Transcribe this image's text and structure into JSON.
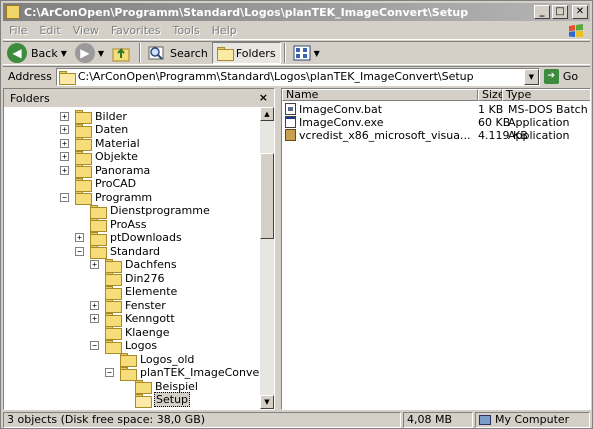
{
  "window": {
    "title": "C:\\ArConOpen\\Programm\\Standard\\Logos\\planTEK_ImageConvert\\Setup",
    "buttons": {
      "minimize": "_",
      "maximize": "□",
      "close": "✕"
    }
  },
  "menu": [
    "File",
    "Edit",
    "View",
    "Favorites",
    "Tools",
    "Help"
  ],
  "toolbar": {
    "back_label": "Back",
    "search_label": "Search",
    "folders_label": "Folders",
    "icons": [
      "back-icon",
      "forward-icon",
      "up-folder-icon",
      "search-icon",
      "folders-icon",
      "views-icon"
    ]
  },
  "address": {
    "label": "Address",
    "path": "C:\\ArConOpen\\Programm\\Standard\\Logos\\planTEK_ImageConvert\\Setup",
    "go_label": "Go"
  },
  "folders_pane": {
    "title": "Folders",
    "close": "×",
    "tree": [
      {
        "label": "Bilder",
        "expander": "+"
      },
      {
        "label": "Daten",
        "expander": "+"
      },
      {
        "label": "Material",
        "expander": "+"
      },
      {
        "label": "Objekte",
        "expander": "+"
      },
      {
        "label": "Panorama",
        "expander": "+"
      },
      {
        "label": "ProCAD",
        "expander": ""
      },
      {
        "label": "Programm",
        "expander": "−"
      },
      {
        "label": "Dienstprogramme",
        "expander": ""
      },
      {
        "label": "ProAss",
        "expander": ""
      },
      {
        "label": "ptDownloads",
        "expander": "+"
      },
      {
        "label": "Standard",
        "expander": "−"
      },
      {
        "label": "Dachfens",
        "expander": "+"
      },
      {
        "label": "Din276",
        "expander": ""
      },
      {
        "label": "Elemente",
        "expander": ""
      },
      {
        "label": "Fenster",
        "expander": "+"
      },
      {
        "label": "Kenngott",
        "expander": "+"
      },
      {
        "label": "Klaenge",
        "expander": ""
      },
      {
        "label": "Logos",
        "expander": "−"
      },
      {
        "label": "Logos_old",
        "expander": ""
      },
      {
        "label": "planTEK_ImageConvert",
        "expander": "−"
      },
      {
        "label": "Beispiel",
        "expander": ""
      },
      {
        "label": "Setup",
        "expander": "",
        "selected": true
      }
    ]
  },
  "files_pane": {
    "columns": {
      "name": "Name",
      "size": "Size",
      "type": "Type"
    },
    "files": [
      {
        "name": "ImageConv.bat",
        "size": "1 KB",
        "type": "MS-DOS Batch File",
        "icon": "batch-file-icon"
      },
      {
        "name": "ImageConv.exe",
        "size": "60 KB",
        "type": "Application",
        "icon": "application-icon"
      },
      {
        "name": "vcredist_x86_microsoft_visua...",
        "size": "4.119 KB",
        "type": "Application",
        "icon": "setup-package-icon"
      }
    ]
  },
  "status": {
    "objects": "3 objects (Disk free space: 38,0 GB)",
    "size": "4,08 MB",
    "zone": "My Computer"
  },
  "colors": {
    "titlebar_inactive": "#808080",
    "window_bg": "#d4d0c8",
    "folder": "#f7dc7a"
  }
}
